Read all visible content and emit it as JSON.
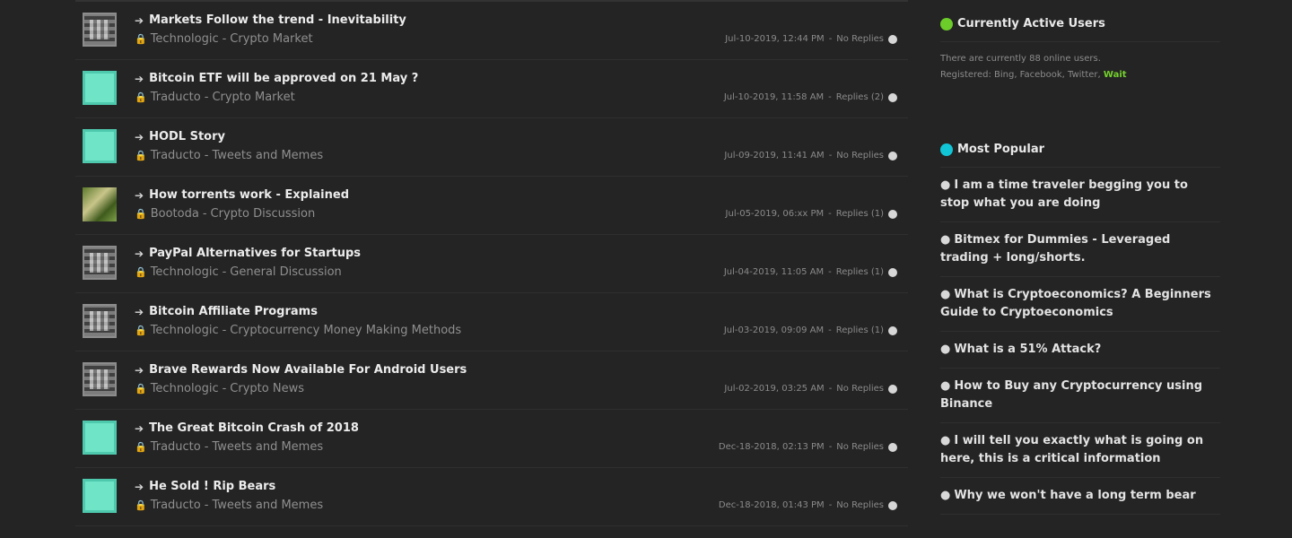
{
  "threads": [
    {
      "title": "Markets Follow the trend - Inevitability",
      "author": "Technologic",
      "forum": "Crypto Market",
      "date": "Jul-10-2019, 12:44 PM",
      "replies": "No Replies",
      "avatar": "qr"
    },
    {
      "title": "Bitcoin ETF will be approved on 21 May ?",
      "author": "Traducto",
      "forum": "Crypto Market",
      "date": "Jul-10-2019, 11:58 AM",
      "replies": "Replies (2)",
      "avatar": "teal"
    },
    {
      "title": "HODL Story",
      "author": "Traducto",
      "forum": "Tweets and Memes",
      "date": "Jul-09-2019, 11:41 AM",
      "replies": "No Replies",
      "avatar": "teal"
    },
    {
      "title": "How torrents work - Explained",
      "author": "Bootoda",
      "forum": "Crypto Discussion",
      "date": "Jul-05-2019, 06:xx PM",
      "replies": "Replies (1)",
      "avatar": "photo"
    },
    {
      "title": "PayPal Alternatives for Startups",
      "author": "Technologic",
      "forum": "General Discussion",
      "date": "Jul-04-2019, 11:05 AM",
      "replies": "Replies (1)",
      "avatar": "qr"
    },
    {
      "title": "Bitcoin Affiliate Programs",
      "author": "Technologic",
      "forum": "Cryptocurrency Money Making Methods",
      "date": "Jul-03-2019, 09:09 AM",
      "replies": "Replies (1)",
      "avatar": "qr"
    },
    {
      "title": "Brave Rewards Now Available For Android Users",
      "author": "Technologic",
      "forum": "Crypto News",
      "date": "Jul-02-2019, 03:25 AM",
      "replies": "No Replies",
      "avatar": "qr"
    },
    {
      "title": "The Great Bitcoin Crash of 2018",
      "author": "Traducto",
      "forum": "Tweets and Memes",
      "date": "Dec-18-2018, 02:13 PM",
      "replies": "No Replies",
      "avatar": "teal"
    },
    {
      "title": "He Sold ! Rip Bears",
      "author": "Traducto",
      "forum": "Tweets and Memes",
      "date": "Dec-18-2018, 01:43 PM",
      "replies": "No Replies",
      "avatar": "teal"
    }
  ],
  "sidebar": {
    "active_title": "Currently Active Users",
    "active_line1": "There are currently 88 online users.",
    "active_line2": "Registered: Bing, Facebook, Twitter,",
    "active_link": "Wait",
    "popular_title": "Most Popular",
    "popular": [
      "I am a time traveler begging you to stop what you are doing",
      "Bitmex for Dummies - Leveraged trading + long/shorts.",
      "What is Cryptoeconomics? A Beginners Guide to Cryptoeconomics",
      "What is a 51% Attack?",
      "How to Buy any Cryptocurrency using Binance",
      "I will tell you exactly what is going on here, this is a critical information",
      "Why we won't have a long term bear"
    ]
  }
}
